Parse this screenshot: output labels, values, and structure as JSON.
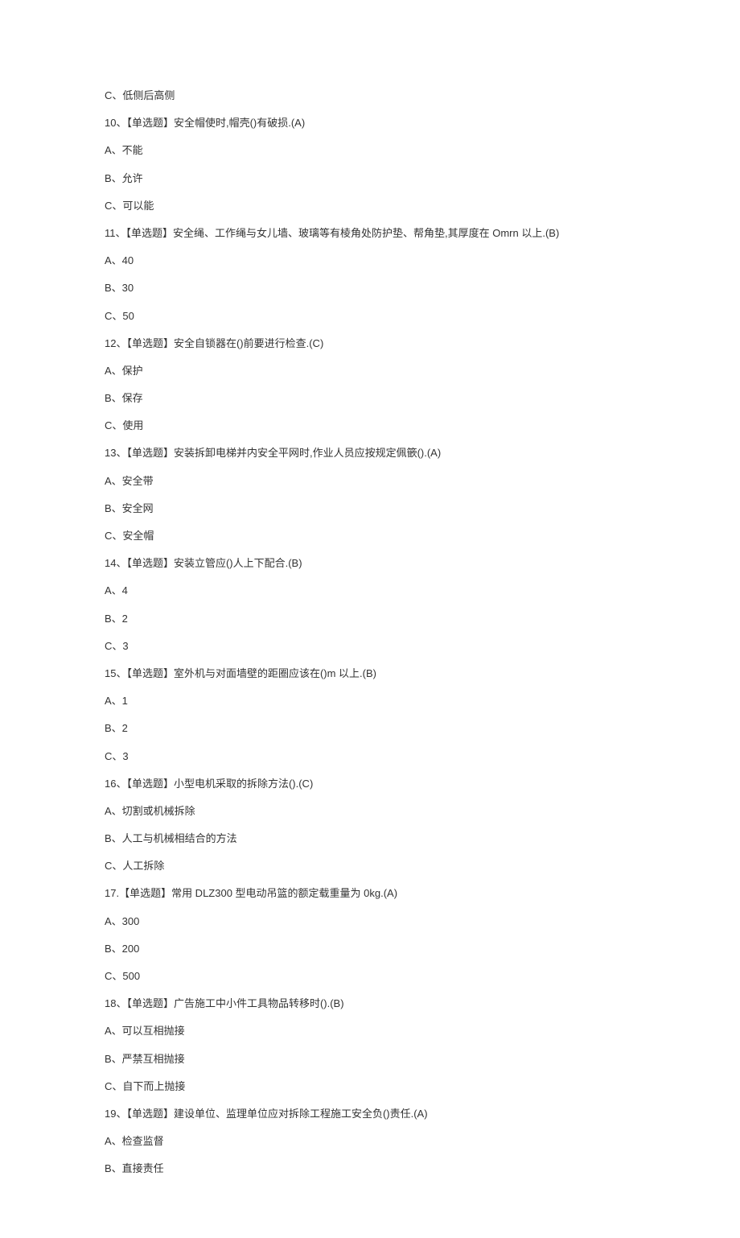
{
  "lines": [
    "C、低侧后高侧",
    "10、【单选题】安全帽使时,帽壳()有破损.(A)",
    "A、不能",
    "B、允许",
    "C、可以能",
    "11、【单选题】安全绳、工作绳与女儿墙、玻璃等有棱角处防护垫、帮角垫,其厚度在 Omrn 以上.(B)",
    "A、40",
    "B、30",
    "C、50",
    "12、【单选题】安全自锁器在()前要进行检查.(C)",
    "A、保护",
    "B、保存",
    "C、使用",
    "13、【单选题】安装拆卸电梯并内安全平网时,作业人员应按规定佩篏().(A)",
    "A、安全带",
    "B、安全网",
    "C、安全帽",
    "14、【单选题】安装立管应()人上下配合.(B)",
    "A、4",
    "B、2",
    "C、3",
    "15、【单选题】室外机与对面墙壁的距圈应该在()m 以上.(B)",
    "A、1",
    "B、2",
    "C、3",
    "16、【单选题】小型电机采取的拆除方法().(C)",
    "A、切割或机械拆除",
    "B、人工与机械相结合的方法",
    "C、人工拆除",
    "17.【单选题】常用 DLZ300 型电动吊篮的额定载重量为 0kg.(A)",
    "A、300",
    "B、200",
    "C、500",
    "18、【单选题】广告施工中小件工具物品转移时().(B)",
    "A、可以互相抛接",
    "B、严禁互相抛接",
    "C、自下而上抛接",
    "19、【单选题】建设单位、监理单位应对拆除工程施工安全负()责任.(A)",
    "A、检查监督",
    "B、直接责任"
  ]
}
